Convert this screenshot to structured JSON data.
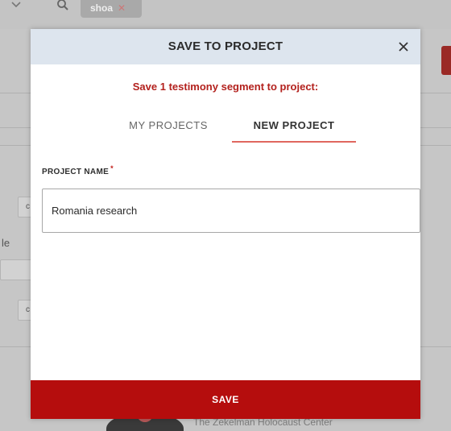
{
  "background": {
    "search_chip_text": "shoa",
    "search_chip_close": "✕",
    "sidebar_fragment_text": "le",
    "sidebar_c_label": "c",
    "footer_org_text": "The Zekelman Holocaust Center"
  },
  "modal": {
    "title": "SAVE TO PROJECT",
    "close_icon": "close-icon",
    "subtitle": "Save 1 testimony segment to project:",
    "tabs": [
      {
        "label": "MY PROJECTS",
        "active": false
      },
      {
        "label": "NEW PROJECT",
        "active": true
      }
    ],
    "field": {
      "label": "PROJECT NAME",
      "required_marker": "*",
      "value": "Romania research"
    },
    "save_label": "SAVE"
  },
  "colors": {
    "header_bg": "#dde5ee",
    "accent_red": "#b3211d",
    "footer_red": "#b50d0d",
    "tab_underline": "#e0675f"
  }
}
